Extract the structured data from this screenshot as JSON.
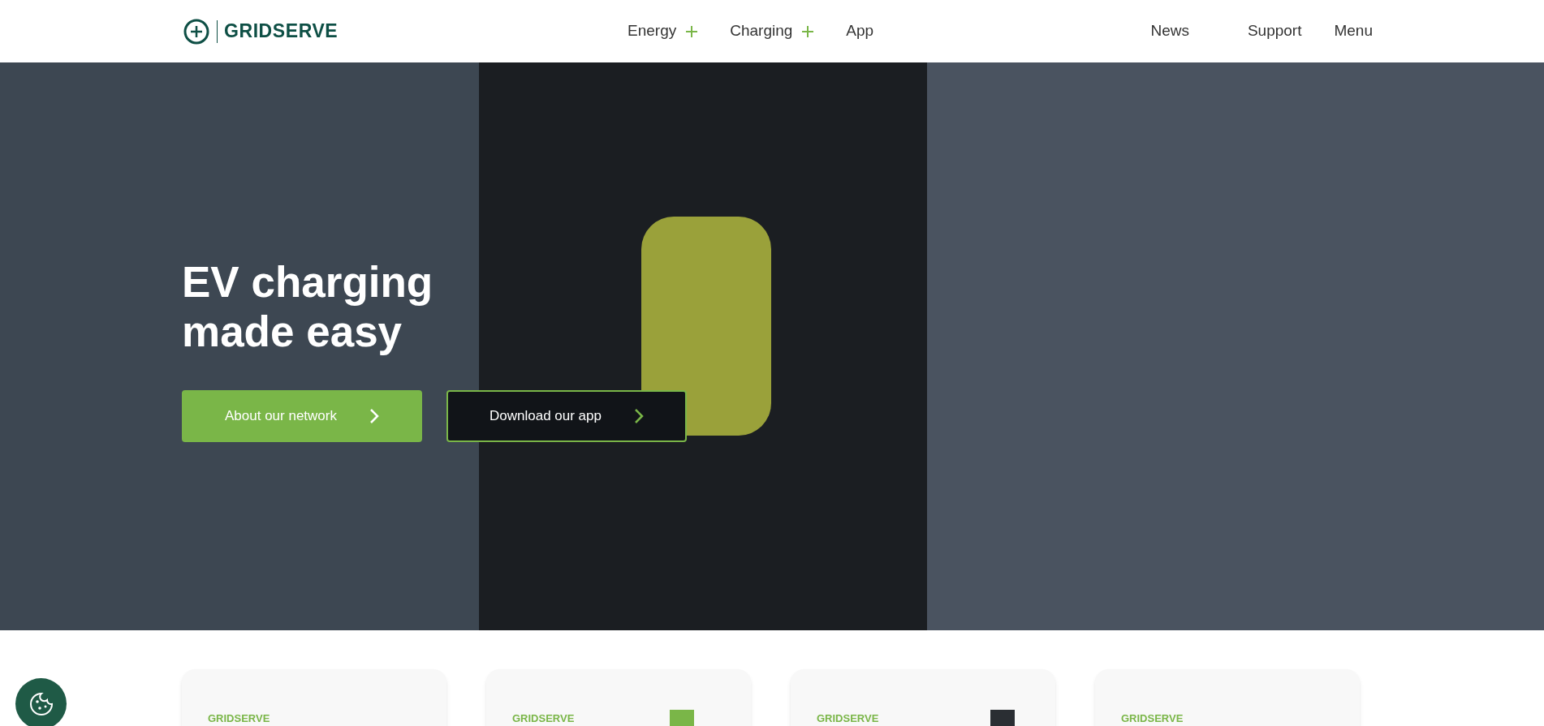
{
  "header": {
    "logo_text": "GRIDSERVE",
    "nav": [
      {
        "label": "Energy",
        "expandable": true
      },
      {
        "label": "Charging",
        "expandable": true
      },
      {
        "label": "App",
        "expandable": false
      }
    ],
    "utility_links": [
      "News",
      "Support",
      "Menu"
    ]
  },
  "hero": {
    "heading_lines": [
      "EV charging",
      "made easy"
    ],
    "buttons": [
      {
        "label": "About our network",
        "kind": "filled"
      },
      {
        "label": "Download our app",
        "kind": "outline"
      }
    ]
  },
  "cards": [
    {
      "brand": "GRIDSERVE",
      "has_image": false
    },
    {
      "brand": "GRIDSERVE",
      "has_image": true
    },
    {
      "brand": "GRIDSERVE",
      "has_image": true
    },
    {
      "brand": "GRIDSERVE",
      "has_image": false
    }
  ]
}
